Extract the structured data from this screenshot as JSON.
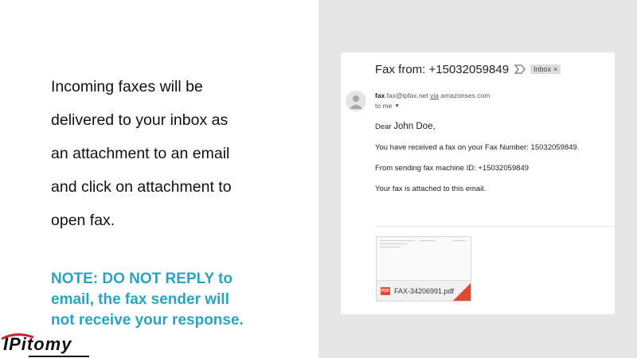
{
  "slide": {
    "body_lines": [
      "Incoming faxes will be",
      "delivered to your inbox as",
      "an attachment to an email",
      "and click on attachment to",
      "open fax."
    ],
    "note_lines": [
      "NOTE: DO NOT REPLY to",
      "email, the fax sender will",
      "not receive your response."
    ],
    "note_color": "#2ba3bf",
    "logo": "IPitomy"
  },
  "email": {
    "subject": "Fax from: +15032059849",
    "label_badge": "Inbox",
    "badge_close": "×",
    "sender_name": "fax",
    "sender_address": "fax@ipfax.net",
    "via_label": "via",
    "via_domain": "amazonses.com",
    "recipient": "to me",
    "greeting_prefix": "Dear",
    "recipient_name": "John Doe,",
    "line1": "You have received a fax on your Fax Number: 15032059849.",
    "line2": "From sending fax machine ID: +15032059849",
    "line3": "Your fax is attached to this email.",
    "attachment": {
      "icon_label": "PDF",
      "filename": "FAX-34206991.pdf",
      "icon_color": "#e04a2f"
    }
  },
  "icons": {
    "important": "importance-marker-icon",
    "avatar": "person-avatar-icon",
    "caret": "chevron-down-icon",
    "pdf": "pdf-icon"
  }
}
